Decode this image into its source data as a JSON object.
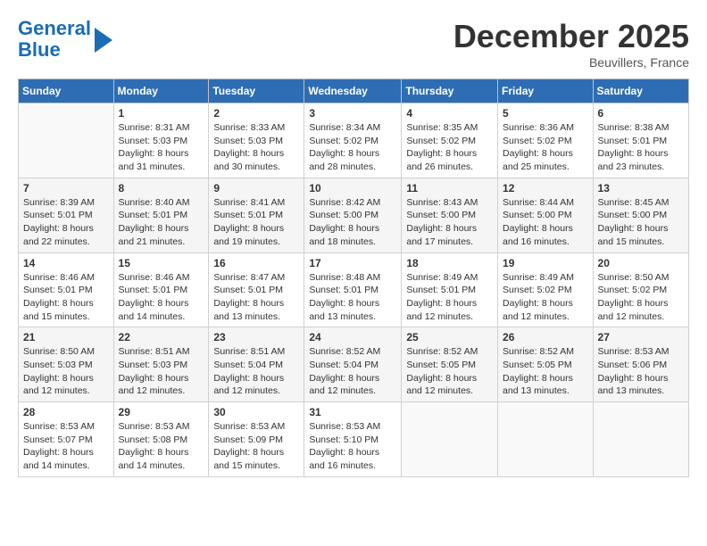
{
  "header": {
    "logo_line1": "General",
    "logo_line2": "Blue",
    "month_title": "December 2025",
    "location": "Beuvillers, France"
  },
  "weekdays": [
    "Sunday",
    "Monday",
    "Tuesday",
    "Wednesday",
    "Thursday",
    "Friday",
    "Saturday"
  ],
  "weeks": [
    [
      {
        "day": "",
        "empty": true
      },
      {
        "day": "1",
        "sunrise": "8:31 AM",
        "sunset": "5:03 PM",
        "daylight": "8 hours and 31 minutes."
      },
      {
        "day": "2",
        "sunrise": "8:33 AM",
        "sunset": "5:03 PM",
        "daylight": "8 hours and 30 minutes."
      },
      {
        "day": "3",
        "sunrise": "8:34 AM",
        "sunset": "5:02 PM",
        "daylight": "8 hours and 28 minutes."
      },
      {
        "day": "4",
        "sunrise": "8:35 AM",
        "sunset": "5:02 PM",
        "daylight": "8 hours and 26 minutes."
      },
      {
        "day": "5",
        "sunrise": "8:36 AM",
        "sunset": "5:02 PM",
        "daylight": "8 hours and 25 minutes."
      },
      {
        "day": "6",
        "sunrise": "8:38 AM",
        "sunset": "5:01 PM",
        "daylight": "8 hours and 23 minutes."
      }
    ],
    [
      {
        "day": "7",
        "sunrise": "8:39 AM",
        "sunset": "5:01 PM",
        "daylight": "8 hours and 22 minutes."
      },
      {
        "day": "8",
        "sunrise": "8:40 AM",
        "sunset": "5:01 PM",
        "daylight": "8 hours and 21 minutes."
      },
      {
        "day": "9",
        "sunrise": "8:41 AM",
        "sunset": "5:01 PM",
        "daylight": "8 hours and 19 minutes."
      },
      {
        "day": "10",
        "sunrise": "8:42 AM",
        "sunset": "5:00 PM",
        "daylight": "8 hours and 18 minutes."
      },
      {
        "day": "11",
        "sunrise": "8:43 AM",
        "sunset": "5:00 PM",
        "daylight": "8 hours and 17 minutes."
      },
      {
        "day": "12",
        "sunrise": "8:44 AM",
        "sunset": "5:00 PM",
        "daylight": "8 hours and 16 minutes."
      },
      {
        "day": "13",
        "sunrise": "8:45 AM",
        "sunset": "5:00 PM",
        "daylight": "8 hours and 15 minutes."
      }
    ],
    [
      {
        "day": "14",
        "sunrise": "8:46 AM",
        "sunset": "5:01 PM",
        "daylight": "8 hours and 15 minutes."
      },
      {
        "day": "15",
        "sunrise": "8:46 AM",
        "sunset": "5:01 PM",
        "daylight": "8 hours and 14 minutes."
      },
      {
        "day": "16",
        "sunrise": "8:47 AM",
        "sunset": "5:01 PM",
        "daylight": "8 hours and 13 minutes."
      },
      {
        "day": "17",
        "sunrise": "8:48 AM",
        "sunset": "5:01 PM",
        "daylight": "8 hours and 13 minutes."
      },
      {
        "day": "18",
        "sunrise": "8:49 AM",
        "sunset": "5:01 PM",
        "daylight": "8 hours and 12 minutes."
      },
      {
        "day": "19",
        "sunrise": "8:49 AM",
        "sunset": "5:02 PM",
        "daylight": "8 hours and 12 minutes."
      },
      {
        "day": "20",
        "sunrise": "8:50 AM",
        "sunset": "5:02 PM",
        "daylight": "8 hours and 12 minutes."
      }
    ],
    [
      {
        "day": "21",
        "sunrise": "8:50 AM",
        "sunset": "5:03 PM",
        "daylight": "8 hours and 12 minutes."
      },
      {
        "day": "22",
        "sunrise": "8:51 AM",
        "sunset": "5:03 PM",
        "daylight": "8 hours and 12 minutes."
      },
      {
        "day": "23",
        "sunrise": "8:51 AM",
        "sunset": "5:04 PM",
        "daylight": "8 hours and 12 minutes."
      },
      {
        "day": "24",
        "sunrise": "8:52 AM",
        "sunset": "5:04 PM",
        "daylight": "8 hours and 12 minutes."
      },
      {
        "day": "25",
        "sunrise": "8:52 AM",
        "sunset": "5:05 PM",
        "daylight": "8 hours and 12 minutes."
      },
      {
        "day": "26",
        "sunrise": "8:52 AM",
        "sunset": "5:05 PM",
        "daylight": "8 hours and 13 minutes."
      },
      {
        "day": "27",
        "sunrise": "8:53 AM",
        "sunset": "5:06 PM",
        "daylight": "8 hours and 13 minutes."
      }
    ],
    [
      {
        "day": "28",
        "sunrise": "8:53 AM",
        "sunset": "5:07 PM",
        "daylight": "8 hours and 14 minutes."
      },
      {
        "day": "29",
        "sunrise": "8:53 AM",
        "sunset": "5:08 PM",
        "daylight": "8 hours and 14 minutes."
      },
      {
        "day": "30",
        "sunrise": "8:53 AM",
        "sunset": "5:09 PM",
        "daylight": "8 hours and 15 minutes."
      },
      {
        "day": "31",
        "sunrise": "8:53 AM",
        "sunset": "5:10 PM",
        "daylight": "8 hours and 16 minutes."
      },
      {
        "day": "",
        "empty": true
      },
      {
        "day": "",
        "empty": true
      },
      {
        "day": "",
        "empty": true
      }
    ]
  ]
}
